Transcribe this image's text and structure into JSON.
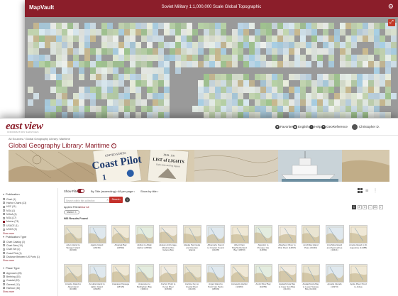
{
  "colors": {
    "brand": "#8b1e2a",
    "search_button": "#c4312b",
    "map_background": "#9a9a9a"
  },
  "mapvault": {
    "logo": "MapVault",
    "title": "Soviet Military 1:1,000,000 Scale Global Topographic",
    "settings_icon": "gear-icon",
    "expand_icon": "expand-icon"
  },
  "eastview": {
    "logo": "east view",
    "logo_sub": "INFORMATION SERVICES",
    "nav": {
      "favorites": "Favorites",
      "language": "English",
      "help": "Help",
      "geo_reference": "GeoReference"
    },
    "user_name": "Christopher D.",
    "breadcrumb": "All Sources  /  Global Geography Library: Maritime",
    "heading": "Global Geography Library: Maritime",
    "banner": {
      "coast_pilot_title": "Coast Pilot",
      "coast_pilot_top": "UNITED STATES",
      "coast_pilot_number": "1",
      "lights_pub": "PUB. 116",
      "lights_title": "LIST of LIGHTS",
      "lights_note": "Radio Aids and Fog Signals"
    },
    "filters": {
      "publication": {
        "title": "Publication",
        "items": [
          {
            "label": "Chart (1)",
            "checked": false
          },
          {
            "label": "Harbor Charts (13)",
            "checked": false
          },
          {
            "label": "HSC (11)",
            "checked": false
          },
          {
            "label": "NGA (1)",
            "checked": false
          },
          {
            "label": "NOAA (2)",
            "checked": false
          },
          {
            "label": "NGA (17)",
            "checked": false
          },
          {
            "label": "Marine (73)",
            "checked": true
          },
          {
            "label": "USACE (1)",
            "checked": false
          },
          {
            "label": "USGS (3)",
            "checked": false
          }
        ],
        "more": "Show more"
      },
      "publication_type": {
        "title": "Publication Type",
        "items": [
          {
            "label": "Chart Catalog (2)",
            "checked": false
          },
          {
            "label": "Chart Sets (10)",
            "checked": false
          },
          {
            "label": "Chart Set (1)",
            "checked": false
          },
          {
            "label": "Coast Pilot (1)",
            "checked": false
          },
          {
            "label": "Distance Between US Ports (1)",
            "checked": false
          }
        ],
        "more": "Show more"
      },
      "place_type": {
        "title": "Place Type",
        "items": [
          {
            "label": "Approach (25)",
            "checked": false
          },
          {
            "label": "Berthing (15)",
            "checked": false
          },
          {
            "label": "Coastal (22)",
            "checked": false
          },
          {
            "label": "General (11)",
            "checked": false
          },
          {
            "label": "Harbour (33)",
            "checked": false
          }
        ],
        "more": "Show more"
      }
    },
    "toolbar": {
      "show_filters": "Show Filters",
      "sort": "By Title (ascending)",
      "per_page": "48 per page",
      "show": "Show by title"
    },
    "search": {
      "placeholder": "Search within this collection",
      "button": "Search",
      "help_icon": "question-icon"
    },
    "applied_filters_label": "Applied Filters:",
    "clear_all": "Clear All",
    "chip": "Marine",
    "results_count": "983 Results Found",
    "pager": [
      "1",
      "2",
      "3",
      "...",
      "21",
      ">"
    ],
    "items_row1": [
      "Aden Island to Tanager Island (18430)",
      "Agattu Island (16435)",
      "Afognak Bay (16592)",
      "Akhiok to Alitak Harbor (16599)",
      "Akutan Anchorage, Alitak Harbor, Galena Bay",
      "Alaska Peninsula and Aleutian Islands",
      "Albemarle Sound to Croatan Sound (12205)",
      "Albert Dam Bay/Sutherland Bay (18453)",
      "Algonkin to Presque Isle (14864)",
      "Allegheny River to Ohio River (14847)",
      "Amchitka Island Pass (16440)",
      "Amchitka Island and Approaches (16441)",
      "Amelia Island to St. Augustine (11488)"
    ],
    "items_row2": [
      "Amukta Island to Atka Island (16480)",
      "Amukta Island to Igitkin Island (16486)",
      "Anacapa Passage (18729)",
      "Anacortes to Bellingham Bay (18424)",
      "Anchor Point to Kenai River (16662)",
      "Anclote Key to Crystal River (11409)",
      "Angel Island to Point San Pedro (18649)",
      "Annapolis Harbor (12283)",
      "Anvik River Bay (16253)",
      "Apalachicola Bay to Cape San Blas (11401)",
      "Apalachicola Bay to Lower Nassau Bay (11404)",
      "Apostle Islands (14973)",
      "Apple River Pond to Ardea"
    ]
  }
}
